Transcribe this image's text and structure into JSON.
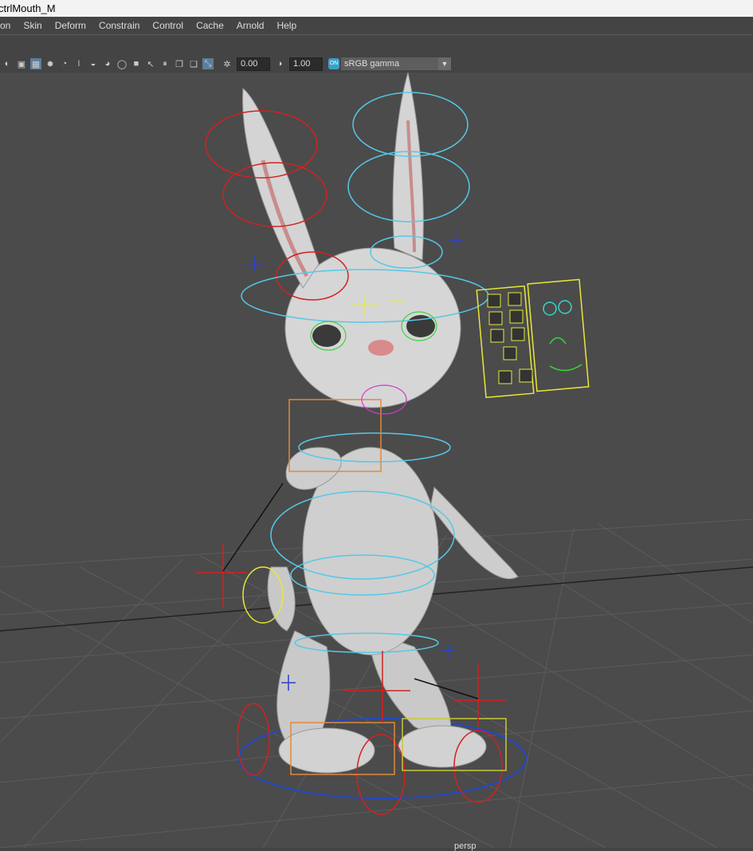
{
  "window": {
    "title": "ctrlMouth_M"
  },
  "menu": {
    "items": [
      "on",
      "Skin",
      "Deform",
      "Constrain",
      "Control",
      "Cache",
      "Arnold",
      "Help"
    ]
  },
  "toolbar": {
    "exposure_value": "0.00",
    "gamma_value": "1.00",
    "colorspace_badge": "ON",
    "colorspace_select": "sRGB gamma",
    "icons": [
      "light-icon",
      "cube-icon",
      "checker-icon",
      "sun-icon",
      "shadow-icon",
      "bulb-icon",
      "ao-icon",
      "aa-icon",
      "ring-icon",
      "square-icon",
      "cursor-icon",
      "frame-icon",
      "copy-icon",
      "resize-icon",
      "aperture-icon",
      "exposure-toggle-icon"
    ]
  },
  "viewport": {
    "camera_label": "persp"
  },
  "colors": {
    "accent": "#5d7d9a",
    "grid": "#5a5a5a",
    "background": "#4b4b4b"
  }
}
